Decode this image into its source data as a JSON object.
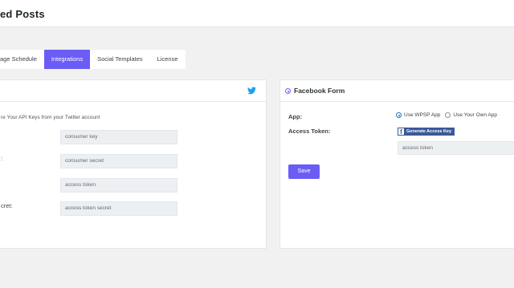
{
  "header": {
    "title": "ed Posts"
  },
  "tabs": [
    {
      "label": "age Schedule"
    },
    {
      "label": "Integrations"
    },
    {
      "label": "Social Templates"
    },
    {
      "label": "License"
    }
  ],
  "twitter": {
    "intro": "re Your API Keys from your Twitter account",
    "fields": [
      {
        "label": "",
        "placeholder": "consumer key"
      },
      {
        "label": ":",
        "placeholder": "consumer secret"
      },
      {
        "label": "",
        "placeholder": "access token"
      },
      {
        "label": "cret:",
        "placeholder": "access token secret"
      }
    ],
    "icon": "twitter-icon",
    "icon_color": "#1da1f2"
  },
  "facebook": {
    "title": "Facebook Form",
    "app_label": "App:",
    "app_options": [
      "Use WPSP App",
      "Use Your Own App"
    ],
    "app_selected": "Use WPSP App",
    "token_label": "Access Token:",
    "generate_button": "Generate Access Key",
    "token_placeholder": "access token",
    "save_button": "Save"
  },
  "colors": {
    "accent": "#6b5cf6",
    "facebook": "#3b5998"
  }
}
